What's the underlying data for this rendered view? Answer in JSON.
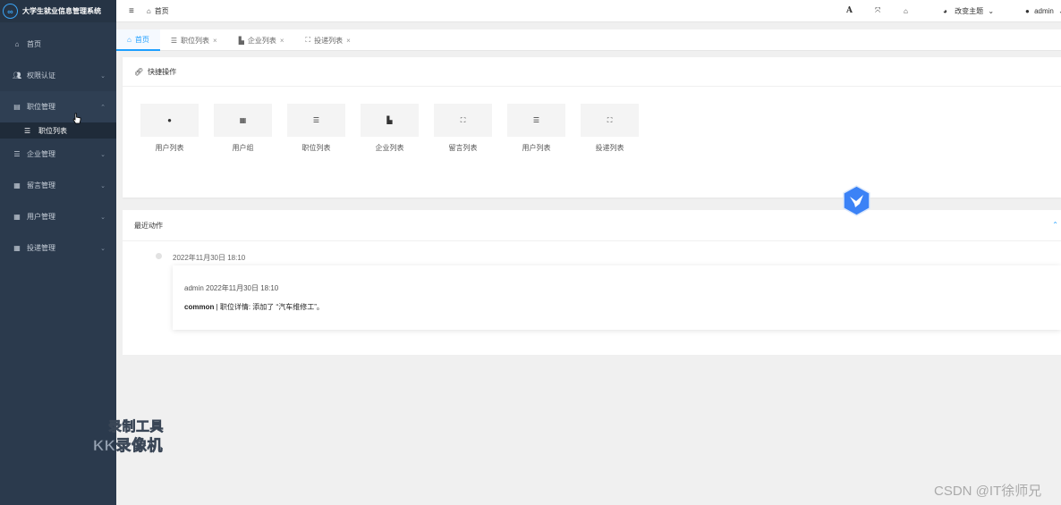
{
  "app": {
    "title": "大学生就业信息管理系统",
    "logo_glyph": "∞"
  },
  "sidebar": {
    "items": [
      {
        "label": "首页",
        "icon": "home-icon"
      },
      {
        "label": "权限认证",
        "icon": "user-group-icon"
      },
      {
        "label": "职位管理",
        "icon": "list-box-icon",
        "expanded": true
      },
      {
        "label": "企业管理",
        "icon": "list-icon"
      },
      {
        "label": "留言管理",
        "icon": "grid-icon"
      },
      {
        "label": "用户管理",
        "icon": "grid-small-icon"
      },
      {
        "label": "投递管理",
        "icon": "grid-icon"
      }
    ],
    "sub_item": {
      "label": "职位列表",
      "icon": "list-icon"
    }
  },
  "topbar": {
    "breadcrumb": "首页",
    "font_btn": "A",
    "theme_label": "改变主题",
    "user_label": "admin"
  },
  "tabs": [
    {
      "label": "首页",
      "icon": "home-icon",
      "active": true
    },
    {
      "label": "职位列表",
      "icon": "list-icon"
    },
    {
      "label": "企业列表",
      "icon": "factory-icon"
    },
    {
      "label": "投递列表",
      "icon": "picture-icon"
    }
  ],
  "quick": {
    "title": "快捷操作",
    "items": [
      {
        "label": "用户列表",
        "icon": "user-icon",
        "glyph": "●"
      },
      {
        "label": "用户组",
        "icon": "table-icon",
        "glyph": "▦"
      },
      {
        "label": "职位列表",
        "icon": "list-icon",
        "glyph": "☰"
      },
      {
        "label": "企业列表",
        "icon": "factory-icon",
        "glyph": "▙"
      },
      {
        "label": "留言列表",
        "icon": "picture-icon",
        "glyph": "⛶"
      },
      {
        "label": "用户列表",
        "icon": "indent-list-icon",
        "glyph": "☰"
      },
      {
        "label": "投递列表",
        "icon": "picture-icon",
        "glyph": "⛶"
      }
    ]
  },
  "recent": {
    "title": "最近动作",
    "entries": [
      {
        "date": "2022年11月30日 18:10",
        "meta": "admin 2022年11月30日 18:10",
        "module": "common",
        "text": " | 职位详情: 添加了 “汽车维修工”。"
      }
    ]
  },
  "watermarks": {
    "line1": "录制工具",
    "line2": "KK录像机",
    "csdn": "CSDN @IT徐师兄"
  },
  "colors": {
    "sidebar": "#2b3a4d",
    "accent": "#1e9fff",
    "badge": "#3b82f6"
  }
}
